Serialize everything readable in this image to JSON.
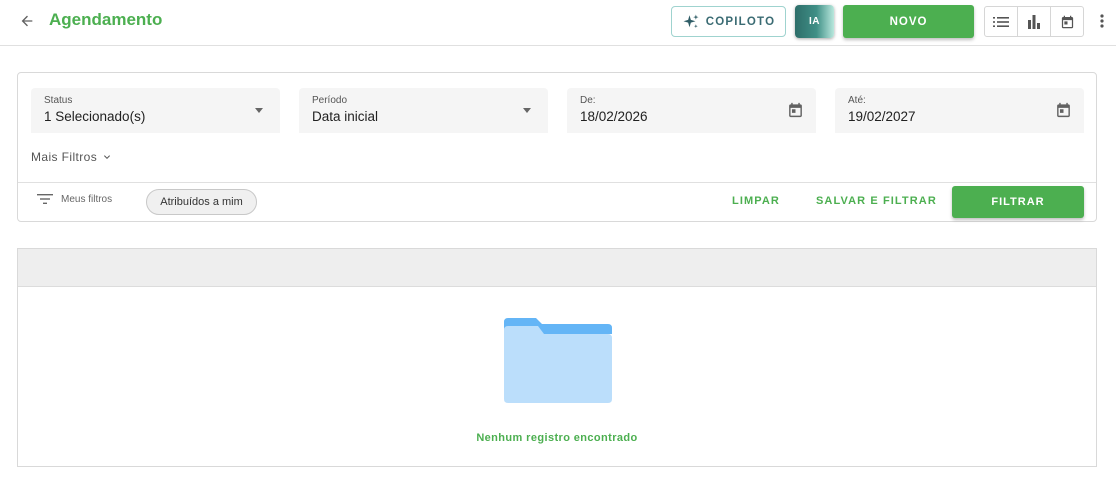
{
  "header": {
    "title": "Agendamento",
    "copilot_label": "COPILOTO",
    "ia_label": "IA",
    "novo_label": "NOVO",
    "views": [
      {
        "name": "list-view",
        "icon": "list-icon"
      },
      {
        "name": "chart-view",
        "icon": "bar-chart-icon"
      },
      {
        "name": "calendar-view",
        "icon": "calendar-icon"
      }
    ]
  },
  "filters": {
    "status": {
      "label": "Status",
      "value": "1 Selecionado(s)"
    },
    "periodo": {
      "label": "Período",
      "value": "Data inicial"
    },
    "de": {
      "label": "De:",
      "value": "18/02/2026"
    },
    "ate": {
      "label": "Até:",
      "value": "19/02/2027"
    },
    "more_label": "Mais Filtros",
    "my_filters_label": "Meus filtros",
    "chip_label": "Atribuídos a mim",
    "clear_label": "LIMPAR",
    "save_filter_label": "SALVAR E FILTRAR",
    "filter_label": "FILTRAR"
  },
  "results": {
    "empty_message": "Nenhum registro encontrado"
  },
  "colors": {
    "primary": "#4caf50",
    "folder_back": "#64b5f6",
    "folder_front": "#bbdefb"
  }
}
